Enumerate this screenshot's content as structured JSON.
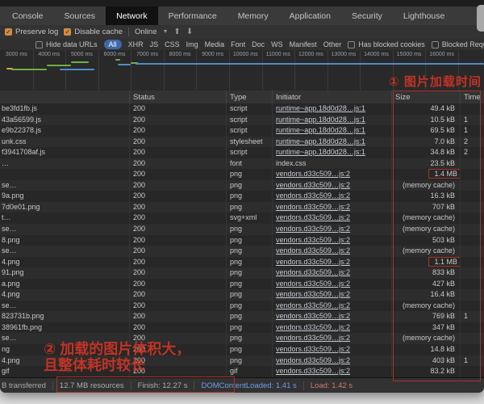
{
  "devtools": {
    "tabs": [
      "Console",
      "Sources",
      "Network",
      "Performance",
      "Memory",
      "Application",
      "Security",
      "Lighthouse"
    ],
    "selected_tab": "Network",
    "toolbar": {
      "preserve_log": "Preserve log",
      "disable_cache": "Disable cache",
      "throttling": "Online"
    },
    "filter_bar": {
      "hide_data_urls": "Hide data URLs",
      "types": [
        "All",
        "XHR",
        "JS",
        "CSS",
        "Img",
        "Media",
        "Font",
        "Doc",
        "WS",
        "Manifest",
        "Other"
      ],
      "selected_type": "All",
      "has_blocked_cookies": "Has blocked cookies",
      "blocked_requests": "Blocked Requests"
    },
    "overview_ticks": [
      "3000 ms",
      "4000 ms",
      "5000 ms",
      "6000 ms",
      "7000 ms",
      "8000 ms",
      "9000 ms",
      "10000 ms",
      "11000 ms",
      "12000 ms",
      "13000 ms",
      "14000 ms",
      "15000 ms",
      "16000 ms"
    ],
    "annotations": {
      "note1": "① 图片加载时间",
      "note2_line1": "② 加载的图片体积大，",
      "note2_line2": "且整体耗时较长",
      "color": "#c13326"
    },
    "table": {
      "headers": [
        "",
        "Status",
        "Type",
        "Initiator",
        "Size",
        "Time"
      ],
      "rows": [
        {
          "name": "be3fd1fb.js",
          "status": "200",
          "type": "script",
          "initiator": "runtime~app.18d0d28…js:1",
          "size": "49.4 kB",
          "time": ""
        },
        {
          "name": "43a56599.js",
          "status": "200",
          "type": "script",
          "initiator": "runtime~app.18d0d28…js:1",
          "size": "10.5 kB",
          "time": "1"
        },
        {
          "name": "e9b22378.js",
          "status": "200",
          "type": "script",
          "initiator": "runtime~app.18d0d28…js:1",
          "size": "69.5 kB",
          "time": "1"
        },
        {
          "name": "unk.css",
          "status": "200",
          "type": "stylesheet",
          "initiator": "runtime~app.18d0d28…js:1",
          "size": "7.0 kB",
          "time": "2"
        },
        {
          "name": "f3941708af.js",
          "status": "200",
          "type": "script",
          "initiator": "runtime~app.18d0d28…js:1",
          "size": "34.8 kB",
          "time": "2"
        },
        {
          "name": "…",
          "status": "200",
          "type": "font",
          "initiator": "index.css",
          "size": "23.5 kB",
          "time": "",
          "link": false
        },
        {
          "name": "",
          "status": "200",
          "type": "png",
          "initiator": "vendors.d33c509…js:2",
          "size": "1.4 MB",
          "time": "",
          "size_boxed": true
        },
        {
          "name": "se…",
          "status": "200",
          "type": "png",
          "initiator": "vendors.d33c509…js:2",
          "size": "(memory cache)",
          "time": ""
        },
        {
          "name": "9a.png",
          "status": "200",
          "type": "png",
          "initiator": "vendors.d33c509…js:2",
          "size": "16.3 kB",
          "time": ""
        },
        {
          "name": "7d0e01.png",
          "status": "200",
          "type": "png",
          "initiator": "vendors.d33c509…js:2",
          "size": "707 kB",
          "time": ""
        },
        {
          "name": "t…",
          "status": "200",
          "type": "svg+xml",
          "initiator": "vendors.d33c509…js:2",
          "size": "(memory cache)",
          "time": ""
        },
        {
          "name": "se…",
          "status": "200",
          "type": "png",
          "initiator": "vendors.d33c509…js:2",
          "size": "(memory cache)",
          "time": ""
        },
        {
          "name": "8.png",
          "status": "200",
          "type": "png",
          "initiator": "vendors.d33c509…js:2",
          "size": "503 kB",
          "time": ""
        },
        {
          "name": "se…",
          "status": "200",
          "type": "png",
          "initiator": "vendors.d33c509…js:2",
          "size": "(memory cache)",
          "time": ""
        },
        {
          "name": "4.png",
          "status": "200",
          "type": "png",
          "initiator": "vendors.d33c509…js:2",
          "size": "1.1 MB",
          "time": "",
          "size_boxed": true
        },
        {
          "name": "91.png",
          "status": "200",
          "type": "png",
          "initiator": "vendors.d33c509…js:2",
          "size": "833 kB",
          "time": ""
        },
        {
          "name": "a.png",
          "status": "200",
          "type": "png",
          "initiator": "vendors.d33c509…js:2",
          "size": "427 kB",
          "time": ""
        },
        {
          "name": "4.png",
          "status": "200",
          "type": "png",
          "initiator": "vendors.d33c509…js:2",
          "size": "16.4 kB",
          "time": ""
        },
        {
          "name": "se…",
          "status": "200",
          "type": "png",
          "initiator": "vendors.d33c509…js:2",
          "size": "(memory cache)",
          "time": ""
        },
        {
          "name": "823731b.png",
          "status": "200",
          "type": "png",
          "initiator": "vendors.d33c509…js:2",
          "size": "769 kB",
          "time": "1"
        },
        {
          "name": "38961fb.png",
          "status": "200",
          "type": "png",
          "initiator": "vendors.d33c509…js:2",
          "size": "347 kB",
          "time": ""
        },
        {
          "name": "se…",
          "status": "200",
          "type": "png",
          "initiator": "vendors.d33c509…js:2",
          "size": "(memory cache)",
          "time": ""
        },
        {
          "name": "ng",
          "status": "200",
          "type": "png",
          "initiator": "vendors.d33c509…js:2",
          "size": "14.8 kB",
          "time": ""
        },
        {
          "name": "4.png",
          "status": "200",
          "type": "png",
          "initiator": "vendors.d33c509…js:2",
          "size": "403 kB",
          "time": "1"
        },
        {
          "name": "gif",
          "status": "200",
          "type": "gif",
          "initiator": "vendors.d33c509…js:2",
          "size": "83.2 kB",
          "time": ""
        }
      ]
    },
    "status_bar": {
      "transferred": "B transferred",
      "resources": "12.7 MB resources",
      "finish": "Finish: 12.27 s",
      "dom_content_loaded": "DOMContentLoaded: 1.41 s",
      "load": "Load: 1.42 s"
    },
    "colors": {
      "annotation_red": "#c13326",
      "highlight_box_red": "#a83227",
      "waterfall_green": "#6fae41",
      "waterfall_blue": "#4e8cc9",
      "waterfall_orange": "#e8a33d",
      "selected_filter_blue": "#3f69a8",
      "checkbox_checked_orange": "#d78b40",
      "dcl_blue": "#6f9ee8",
      "load_red": "#cf7a72"
    }
  }
}
